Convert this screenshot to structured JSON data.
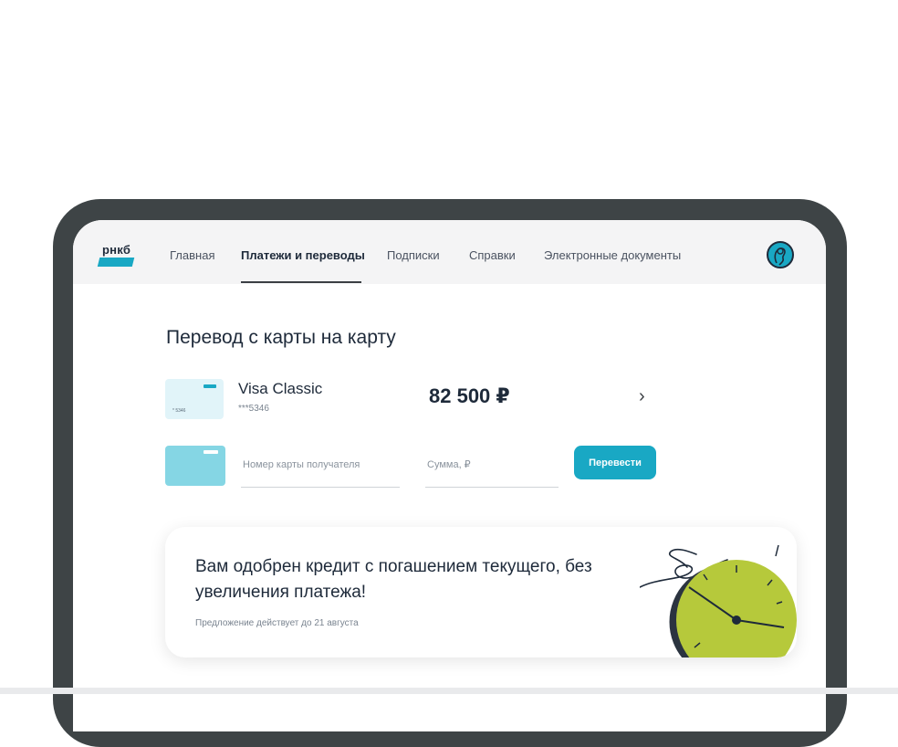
{
  "logo": {
    "text": "рнкб"
  },
  "nav": {
    "items": [
      {
        "label": "Главная",
        "active": false
      },
      {
        "label": "Платежи и переводы",
        "active": true
      },
      {
        "label": "Подписки",
        "active": false
      },
      {
        "label": "Справки",
        "active": false
      },
      {
        "label": "Электронные документы",
        "active": false
      }
    ]
  },
  "page": {
    "title": "Перевод с карты на карту"
  },
  "source_card": {
    "name": "Visa Classic",
    "masked_number": "***5346",
    "thumb_number": "* 5346",
    "balance": "82 500 ₽"
  },
  "transfer_form": {
    "card_number_placeholder": "Номер карты получателя",
    "amount_placeholder": "Сумма, ₽",
    "submit_label": "Перевести"
  },
  "offer": {
    "title": "Вам одобрен кредит с погашением текущего, без увеличения платежа!",
    "note": "Предложение действует до 21 августа"
  },
  "colors": {
    "accent": "#19a8c4",
    "accent_light": "#85d6e4",
    "lime": "#b6c93b",
    "dark": "#1e2a3a",
    "device_frame": "#3e4446"
  },
  "icons": {
    "logo": "rnkb-logo",
    "avatar": "user-avatar-icon",
    "chevron": "chevron-right-icon",
    "offer_illustration": "clock-illustration"
  }
}
